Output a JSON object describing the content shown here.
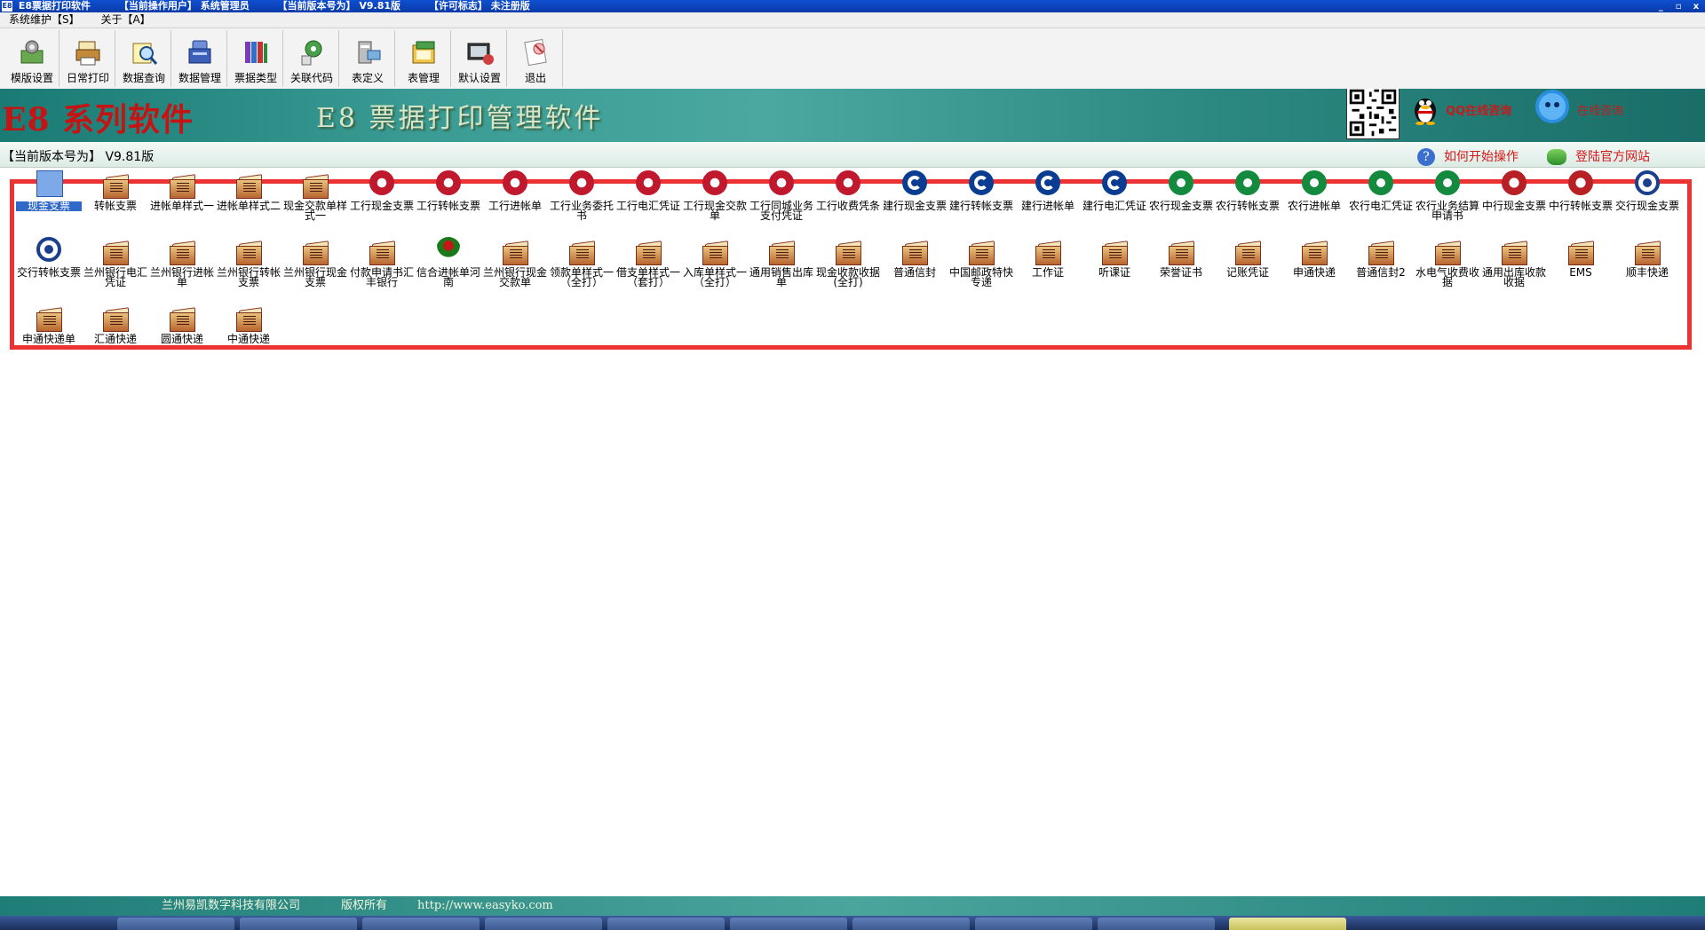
{
  "window": {
    "app_icon": "E8",
    "title_segments": [
      "E8票据打印软件",
      "【当前操作用户】 系统管理员",
      "【当前版本号为】 V9.81版",
      "【许可标志】 未注册版"
    ],
    "controls": [
      "_",
      "▫",
      "x"
    ]
  },
  "menu": [
    "系统维护【S】",
    "关于【A】"
  ],
  "toolbar": [
    {
      "label": "模版设置",
      "icon": "template-settings-icon"
    },
    {
      "label": "日常打印",
      "icon": "printer-icon"
    },
    {
      "label": "数据查询",
      "icon": "data-search-icon"
    },
    {
      "label": "数据管理",
      "icon": "data-manage-icon"
    },
    {
      "label": "票据类型",
      "icon": "ticket-types-icon"
    },
    {
      "label": "关联代码",
      "icon": "link-code-icon"
    },
    {
      "label": "表定义",
      "icon": "table-define-icon"
    },
    {
      "label": "表管理",
      "icon": "table-manage-icon"
    },
    {
      "label": "默认设置",
      "icon": "default-settings-icon"
    },
    {
      "label": "退出",
      "icon": "exit-icon"
    }
  ],
  "banner": {
    "brand": "E8 系列软件",
    "product": "E8 票据打印管理软件",
    "qq_text": "QQ在线咨询",
    "online_text": "在线咨询"
  },
  "version_bar": {
    "text": "【当前版本号为】 V9.81版",
    "howto": "如何开始操作",
    "website": "登陆官方网站"
  },
  "templates": [
    {
      "label": "现金支票",
      "icon": "selected"
    },
    {
      "label": "转帐支票",
      "icon": "book"
    },
    {
      "label": "进帐单样式一",
      "icon": "book"
    },
    {
      "label": "进帐单样式二",
      "icon": "book"
    },
    {
      "label": "现金交款单样式一",
      "icon": "book"
    },
    {
      "label": "工行现金支票",
      "icon": "icbc"
    },
    {
      "label": "工行转帐支票",
      "icon": "icbc"
    },
    {
      "label": "工行进帐单",
      "icon": "icbc"
    },
    {
      "label": "工行业务委托书",
      "icon": "icbc"
    },
    {
      "label": "工行电汇凭证",
      "icon": "icbc"
    },
    {
      "label": "工行现金交款单",
      "icon": "icbc"
    },
    {
      "label": "工行同城业务支付凭证",
      "icon": "icbc"
    },
    {
      "label": "工行收费凭条",
      "icon": "icbc"
    },
    {
      "label": "建行现金支票",
      "icon": "ccb"
    },
    {
      "label": "建行转帐支票",
      "icon": "ccb"
    },
    {
      "label": "建行进帐单",
      "icon": "ccb"
    },
    {
      "label": "建行电汇凭证",
      "icon": "ccb"
    },
    {
      "label": "农行现金支票",
      "icon": "abc"
    },
    {
      "label": "农行转帐支票",
      "icon": "abc"
    },
    {
      "label": "农行进帐单",
      "icon": "abc"
    },
    {
      "label": "农行电汇凭证",
      "icon": "abc"
    },
    {
      "label": "农行业务结算申请书",
      "icon": "abc"
    },
    {
      "label": "中行现金支票",
      "icon": "boc"
    },
    {
      "label": "中行转帐支票",
      "icon": "boc"
    },
    {
      "label": "交行现金支票",
      "icon": "bcm"
    },
    {
      "label": "交行转帐支票",
      "icon": "bcm"
    },
    {
      "label": "兰州银行电汇凭证",
      "icon": "book"
    },
    {
      "label": "兰州银行进帐单",
      "icon": "book"
    },
    {
      "label": "兰州银行转帐支票",
      "icon": "book"
    },
    {
      "label": "兰州银行现金支票",
      "icon": "book"
    },
    {
      "label": "付款申请书汇丰银行",
      "icon": "book"
    },
    {
      "label": "信合进帐单河南",
      "icon": "rcc"
    },
    {
      "label": "兰州银行现金交款单",
      "icon": "book"
    },
    {
      "label": "领款单样式一（全打）",
      "icon": "book"
    },
    {
      "label": "借支单样式一（套打）",
      "icon": "book"
    },
    {
      "label": "入库单样式一（全打）",
      "icon": "book"
    },
    {
      "label": "通用销售出库单",
      "icon": "book"
    },
    {
      "label": "现金收款收据(全打)",
      "icon": "book"
    },
    {
      "label": "普通信封",
      "icon": "book"
    },
    {
      "label": "中国邮政特快专递",
      "icon": "book"
    },
    {
      "label": "工作证",
      "icon": "book"
    },
    {
      "label": "听课证",
      "icon": "book"
    },
    {
      "label": "荣誉证书",
      "icon": "book"
    },
    {
      "label": "记账凭证",
      "icon": "book"
    },
    {
      "label": "申通快递",
      "icon": "book"
    },
    {
      "label": "普通信封2",
      "icon": "book"
    },
    {
      "label": "水电气收费收据",
      "icon": "book"
    },
    {
      "label": "通用出库收款收据",
      "icon": "book"
    },
    {
      "label": "EMS",
      "icon": "book"
    },
    {
      "label": "顺丰快递",
      "icon": "book"
    },
    {
      "label": "申通快递单",
      "icon": "book"
    },
    {
      "label": "汇通快递",
      "icon": "book"
    },
    {
      "label": "圆通快递",
      "icon": "book"
    },
    {
      "label": "中通快递",
      "icon": "book"
    }
  ],
  "footer": {
    "company": "兰州易凯数字科技有限公司",
    "rights": "版权所有",
    "url": "http://www.easyko.com"
  },
  "colors": {
    "title_bar": "#0a3aa8",
    "banner": "#3a9c94",
    "brand_red": "#c41414",
    "highlight_box": "#ec3232",
    "selection": "#3069c7"
  }
}
